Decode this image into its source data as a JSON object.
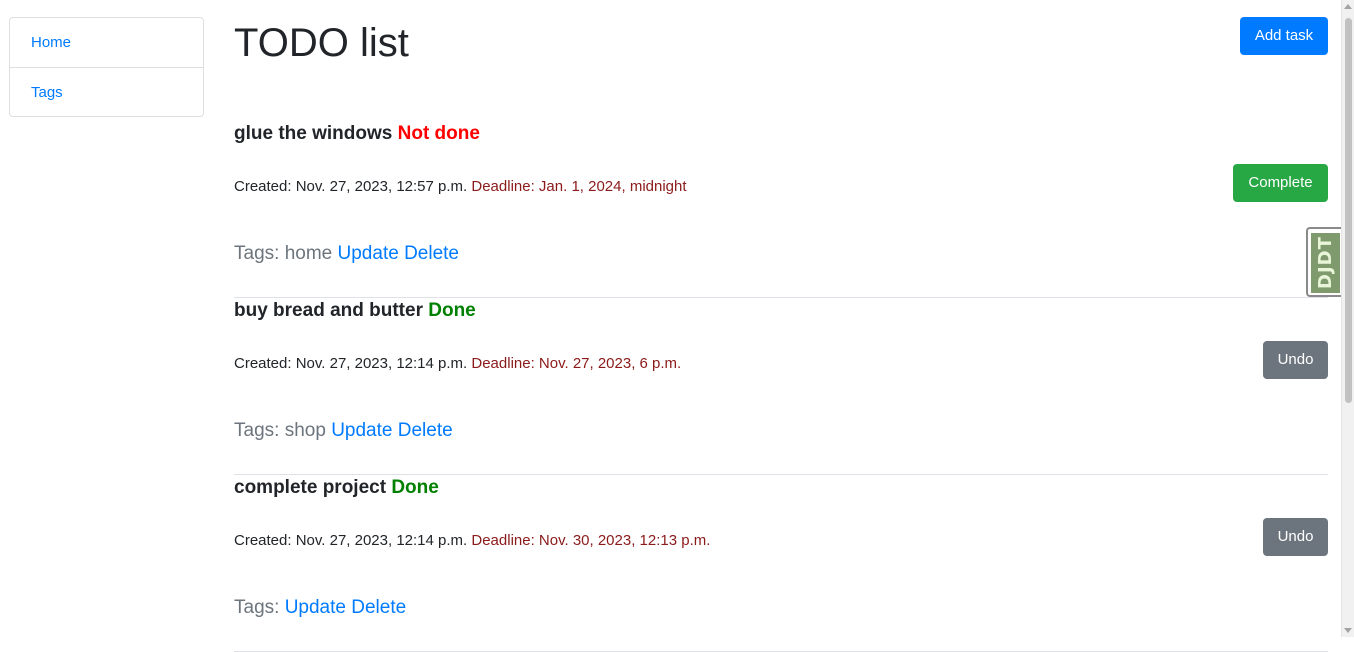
{
  "nav": {
    "items": [
      {
        "label": "Home"
      },
      {
        "label": "Tags"
      }
    ]
  },
  "page": {
    "title": "TODO list",
    "add_task_label": "Add task"
  },
  "tasks": [
    {
      "title": "glue the windows",
      "status": "Not done",
      "created": "Created: Nov. 27, 2023, 12:57 p.m.",
      "deadline": "Deadline: Jan. 1, 2024, midnight",
      "tags_label": "Tags:",
      "tags": "home",
      "action_label": "Complete",
      "update_label": "Update",
      "delete_label": "Delete"
    },
    {
      "title": "buy bread and butter",
      "status": "Done",
      "created": "Created: Nov. 27, 2023, 12:14 p.m.",
      "deadline": "Deadline: Nov. 27, 2023, 6 p.m.",
      "tags_label": "Tags:",
      "tags": "shop",
      "action_label": "Undo",
      "update_label": "Update",
      "delete_label": "Delete"
    },
    {
      "title": "complete project",
      "status": "Done",
      "created": "Created: Nov. 27, 2023, 12:14 p.m.",
      "deadline": "Deadline: Nov. 30, 2023, 12:13 p.m.",
      "tags_label": "Tags:",
      "tags": "",
      "action_label": "Undo",
      "update_label": "Update",
      "delete_label": "Delete"
    }
  ],
  "debug_toolbar": {
    "label": "DJDT"
  },
  "colors": {
    "primary": "#007bff",
    "success": "#28a745",
    "secondary": "#6c757d",
    "not_done": "#ff0000",
    "done": "#008000",
    "deadline": "#8b1a1a"
  }
}
